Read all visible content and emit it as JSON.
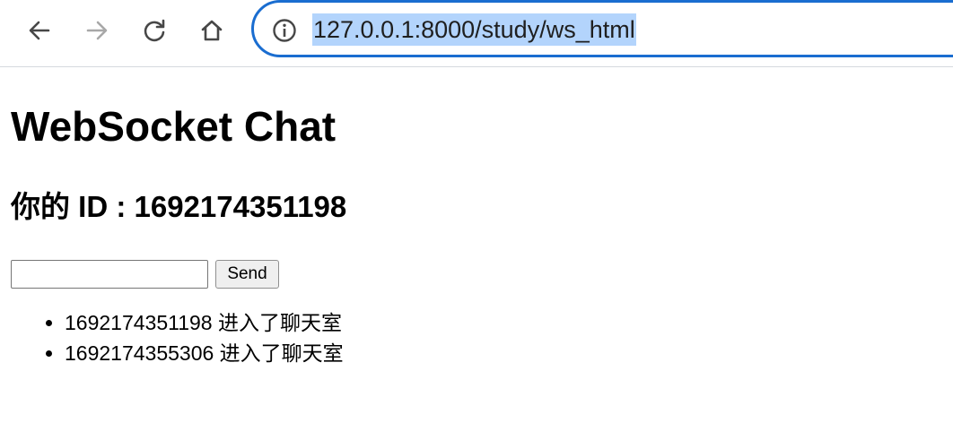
{
  "browser": {
    "url": "127.0.0.1:8000/study/ws_html",
    "back_icon": "arrow-left",
    "forward_icon": "arrow-right",
    "reload_icon": "reload",
    "home_icon": "home",
    "site_info_icon": "info-circle",
    "accent_color": "#1a6dd0",
    "selection_color": "#b3d4fc"
  },
  "page": {
    "title": "WebSocket Chat",
    "id_line": "你的 ID : 1692174351198",
    "input": {
      "value": "",
      "placeholder": ""
    },
    "send_label": "Send",
    "messages": [
      "1692174351198 进入了聊天室",
      "1692174355306 进入了聊天室"
    ]
  }
}
